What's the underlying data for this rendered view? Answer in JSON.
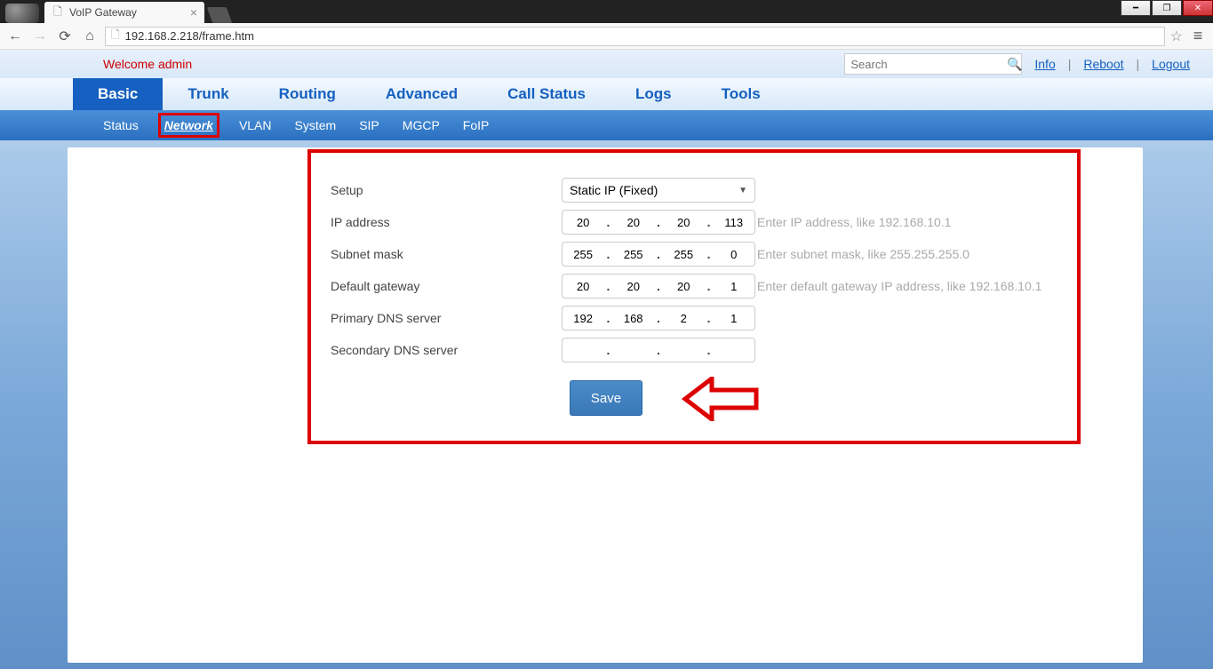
{
  "browser": {
    "tab_title": "VoIP Gateway",
    "url": "192.168.2.218/frame.htm"
  },
  "header": {
    "welcome": "Welcome admin",
    "search_placeholder": "Search",
    "info": "Info",
    "reboot": "Reboot",
    "logout": "Logout"
  },
  "main_nav": [
    "Basic",
    "Trunk",
    "Routing",
    "Advanced",
    "Call Status",
    "Logs",
    "Tools"
  ],
  "sub_nav": [
    "Status",
    "Network",
    "VLAN",
    "System",
    "SIP",
    "MGCP",
    "FoIP"
  ],
  "sub_nav_active": 1,
  "form": {
    "setup_label": "Setup",
    "setup_value": "Static IP (Fixed)",
    "ip_label": "IP address",
    "ip": [
      "20",
      "20",
      "20",
      "113"
    ],
    "ip_hint": "Enter IP address, like 192.168.10.1",
    "mask_label": "Subnet mask",
    "mask": [
      "255",
      "255",
      "255",
      "0"
    ],
    "mask_hint": "Enter subnet mask, like 255.255.255.0",
    "gw_label": "Default gateway",
    "gw": [
      "20",
      "20",
      "20",
      "1"
    ],
    "gw_hint": "Enter default gateway IP address, like 192.168.10.1",
    "dns1_label": "Primary DNS server",
    "dns1": [
      "192",
      "168",
      "2",
      "1"
    ],
    "dns2_label": "Secondary DNS server",
    "dns2": [
      "",
      "",
      "",
      ""
    ],
    "save": "Save"
  }
}
